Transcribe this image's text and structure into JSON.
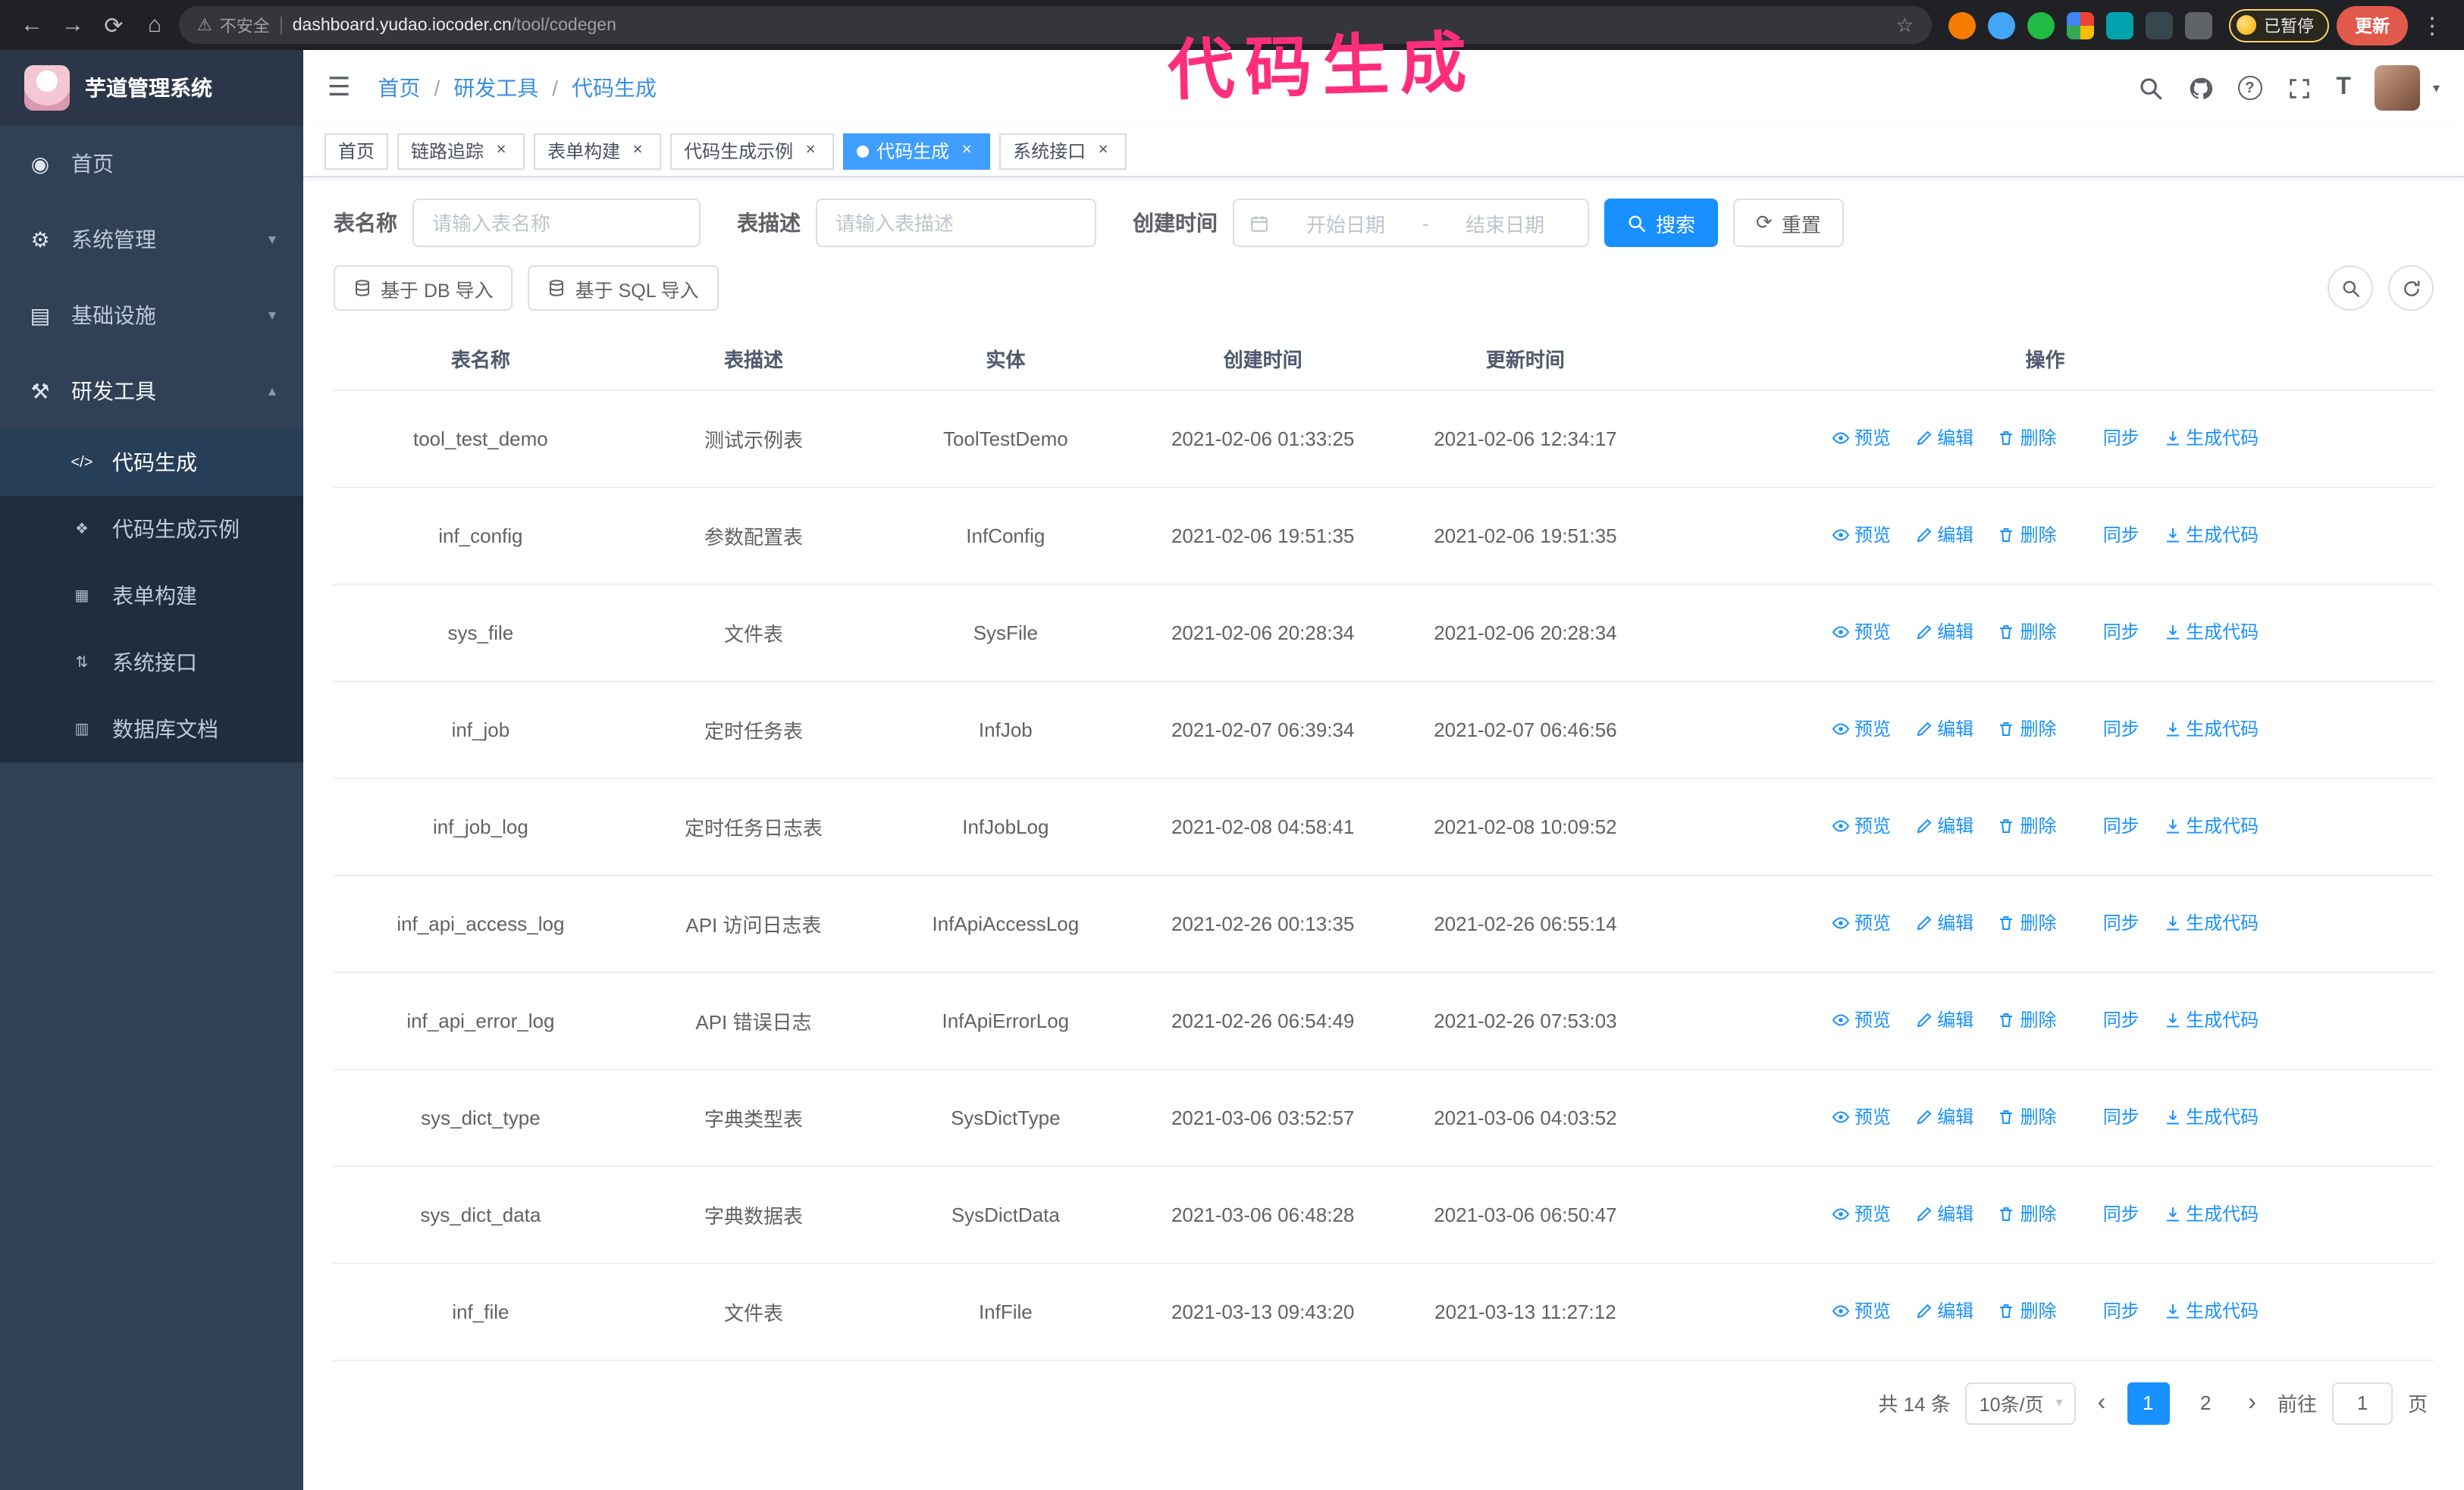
{
  "browser": {
    "security_label": "不安全",
    "url_domain": "dashboard.yudao.iocoder.cn",
    "url_path": "/tool/codegen",
    "paused_label": "已暂停",
    "update_label": "更新"
  },
  "annotation": {
    "text": "代码生成"
  },
  "colors": {
    "accent": "#1890ff",
    "tag_active": "#409eff",
    "annotation": "#ff2e7d",
    "sidebar_bg": "#304156",
    "submenu_bg": "#1f2d3d"
  },
  "icons": {
    "back": "←",
    "forward": "→",
    "reload": "⟳",
    "home": "⌂",
    "warning": "⚠",
    "star": "☆",
    "kebab": "⋮",
    "hamburger": "☰",
    "caret_down": "▾",
    "chevron_down": "▾",
    "chevron_up": "▴",
    "close": "×",
    "prev": "‹",
    "next": "›",
    "slash": "/",
    "dash": "-",
    "font_size": "T",
    "question": "?"
  },
  "sidebar": {
    "logo_title": "芋道管理系统",
    "items": [
      {
        "label": "首页",
        "glyph": "◉"
      },
      {
        "label": "系统管理",
        "glyph": "⚙"
      },
      {
        "label": "基础设施",
        "glyph": "▤"
      },
      {
        "label": "研发工具",
        "glyph": "⚒"
      }
    ],
    "dev_children": [
      {
        "label": "代码生成",
        "glyph": "</>"
      },
      {
        "label": "代码生成示例",
        "glyph": "❖"
      },
      {
        "label": "表单构建",
        "glyph": "▦"
      },
      {
        "label": "系统接口",
        "glyph": "⇅"
      },
      {
        "label": "数据库文档",
        "glyph": "▥"
      }
    ]
  },
  "breadcrumb": [
    "首页",
    "研发工具",
    "代码生成"
  ],
  "tabs": [
    {
      "label": "首页",
      "closable": false,
      "active": false
    },
    {
      "label": "链路追踪",
      "closable": true,
      "active": false
    },
    {
      "label": "表单构建",
      "closable": true,
      "active": false
    },
    {
      "label": "代码生成示例",
      "closable": true,
      "active": false
    },
    {
      "label": "代码生成",
      "closable": true,
      "active": true
    },
    {
      "label": "系统接口",
      "closable": true,
      "active": false
    }
  ],
  "filters": {
    "table_name_label": "表名称",
    "table_name_placeholder": "请输入表名称",
    "table_desc_label": "表描述",
    "table_desc_placeholder": "请输入表描述",
    "create_time_label": "创建时间",
    "date_start_placeholder": "开始日期",
    "date_end_placeholder": "结束日期",
    "search_label": "搜索",
    "reset_label": "重置"
  },
  "toolbar": {
    "import_db": "基于 DB 导入",
    "import_sql": "基于 SQL 导入"
  },
  "table": {
    "columns": [
      "表名称",
      "表描述",
      "实体",
      "创建时间",
      "更新时间",
      "操作"
    ],
    "actions": [
      "预览",
      "编辑",
      "删除",
      "同步",
      "生成代码"
    ],
    "rows": [
      {
        "name": "tool_test_demo",
        "desc": "测试示例表",
        "entity": "ToolTestDemo",
        "created": "2021-02-06 01:33:25",
        "updated": "2021-02-06 12:34:17"
      },
      {
        "name": "inf_config",
        "desc": "参数配置表",
        "entity": "InfConfig",
        "created": "2021-02-06 19:51:35",
        "updated": "2021-02-06 19:51:35"
      },
      {
        "name": "sys_file",
        "desc": "文件表",
        "entity": "SysFile",
        "created": "2021-02-06 20:28:34",
        "updated": "2021-02-06 20:28:34"
      },
      {
        "name": "inf_job",
        "desc": "定时任务表",
        "entity": "InfJob",
        "created": "2021-02-07 06:39:34",
        "updated": "2021-02-07 06:46:56"
      },
      {
        "name": "inf_job_log",
        "desc": "定时任务日志表",
        "entity": "InfJobLog",
        "created": "2021-02-08 04:58:41",
        "updated": "2021-02-08 10:09:52"
      },
      {
        "name": "inf_api_access_log",
        "desc": "API 访问日志表",
        "entity": "InfApiAccessLog",
        "created": "2021-02-26 00:13:35",
        "updated": "2021-02-26 06:55:14"
      },
      {
        "name": "inf_api_error_log",
        "desc": "API 错误日志",
        "entity": "InfApiErrorLog",
        "created": "2021-02-26 06:54:49",
        "updated": "2021-02-26 07:53:03"
      },
      {
        "name": "sys_dict_type",
        "desc": "字典类型表",
        "entity": "SysDictType",
        "created": "2021-03-06 03:52:57",
        "updated": "2021-03-06 04:03:52"
      },
      {
        "name": "sys_dict_data",
        "desc": "字典数据表",
        "entity": "SysDictData",
        "created": "2021-03-06 06:48:28",
        "updated": "2021-03-06 06:50:47"
      },
      {
        "name": "inf_file",
        "desc": "文件表",
        "entity": "InfFile",
        "created": "2021-03-13 09:43:20",
        "updated": "2021-03-13 11:27:12"
      }
    ]
  },
  "pagination": {
    "total_text": "共 14 条",
    "page_size": "10条/页",
    "pages": [
      "1",
      "2"
    ],
    "active_page": "1",
    "goto_label": "前往",
    "goto_value": "1",
    "goto_suffix": "页"
  }
}
